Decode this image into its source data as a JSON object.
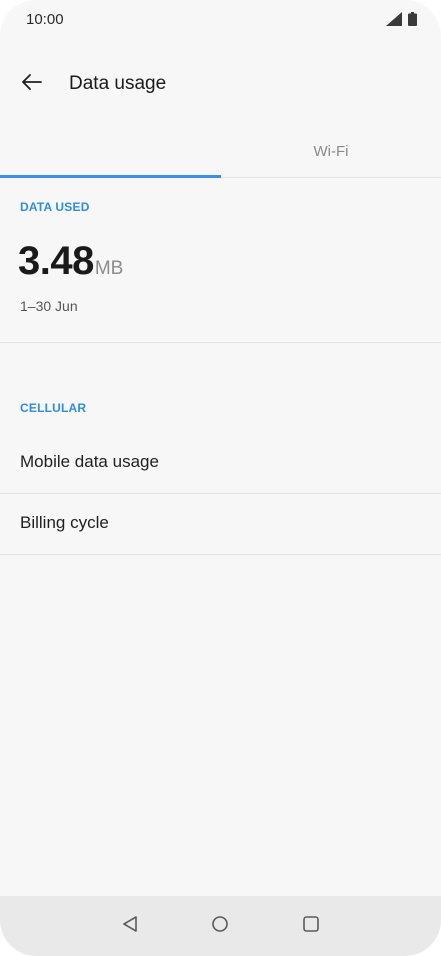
{
  "status_bar": {
    "time": "10:00",
    "icons": [
      "cellular-signal-icon",
      "battery-icon"
    ]
  },
  "app_bar": {
    "back_icon": "arrow-left-icon",
    "title": "Data usage"
  },
  "tabs": [
    {
      "label": "",
      "selected": true
    },
    {
      "label": "Wi-Fi",
      "selected": false
    }
  ],
  "colors": {
    "accent": "#3a8fe0",
    "section_label": "#2f8ed8",
    "background": "#f7f7f7"
  },
  "data_used": {
    "heading": "DATA USED",
    "value": "3.48",
    "unit": "MB",
    "period": "1–30 Jun"
  },
  "cellular": {
    "heading": "CELLULAR",
    "items": [
      {
        "label": "Mobile data usage"
      },
      {
        "label": "Billing cycle"
      }
    ]
  },
  "nav_bar": {
    "icons": [
      "back-triangle-icon",
      "home-circle-icon",
      "recents-square-icon"
    ]
  }
}
